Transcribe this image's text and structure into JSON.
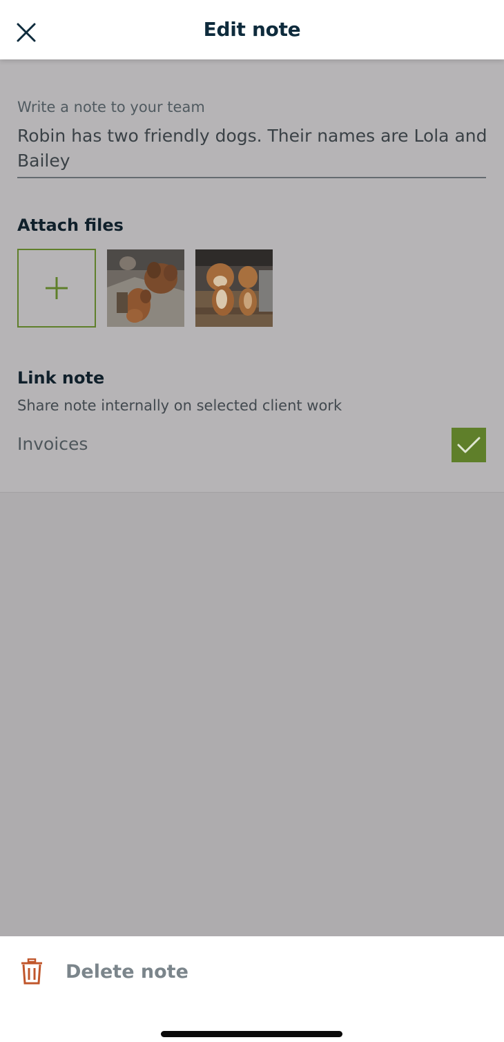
{
  "header": {
    "title": "Edit note",
    "close_icon": "close-icon"
  },
  "note_field": {
    "label": "Write a note to your team",
    "value": "Robin has two friendly dogs. Their names are Lola and Bailey"
  },
  "attach": {
    "heading": "Attach files",
    "add_icon": "plus-icon",
    "files": [
      {
        "type": "photo",
        "subject": "dogs-photo-1"
      },
      {
        "type": "photo",
        "subject": "dogs-photo-2"
      }
    ]
  },
  "link": {
    "heading": "Link note",
    "subtitle": "Share note internally on selected client work",
    "items": [
      {
        "label": "Invoices",
        "checked": true
      }
    ]
  },
  "footer": {
    "delete_label": "Delete note",
    "delete_icon": "trash-icon"
  },
  "colors": {
    "accent_green": "#5f7f2a",
    "delete_red": "#c0562b",
    "title_navy": "#0e2b3c",
    "overlay_gray": "#aeacae"
  }
}
